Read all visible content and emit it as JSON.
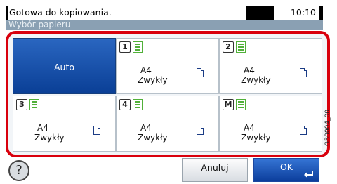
{
  "status": {
    "message": "Gotowa do kopiowania.",
    "time": "10:10"
  },
  "title": "Wybór papieru",
  "auto_label": "Auto",
  "tiles": [
    {
      "tray": "1",
      "size": "A4",
      "type": "Zwykły"
    },
    {
      "tray": "2",
      "size": "A4",
      "type": "Zwykły"
    },
    {
      "tray": "3",
      "size": "A4",
      "type": "Zwykły"
    },
    {
      "tray": "4",
      "size": "A4",
      "type": "Zwykły"
    },
    {
      "tray": "M",
      "size": "A4",
      "type": "Zwykły"
    }
  ],
  "buttons": {
    "help": "?",
    "cancel": "Anuluj",
    "ok": "OK"
  },
  "side_code": "GB0004_00",
  "colors": {
    "highlight": "#d9000d",
    "selected": "#0a3f96",
    "paper_icon": "#51b039"
  }
}
